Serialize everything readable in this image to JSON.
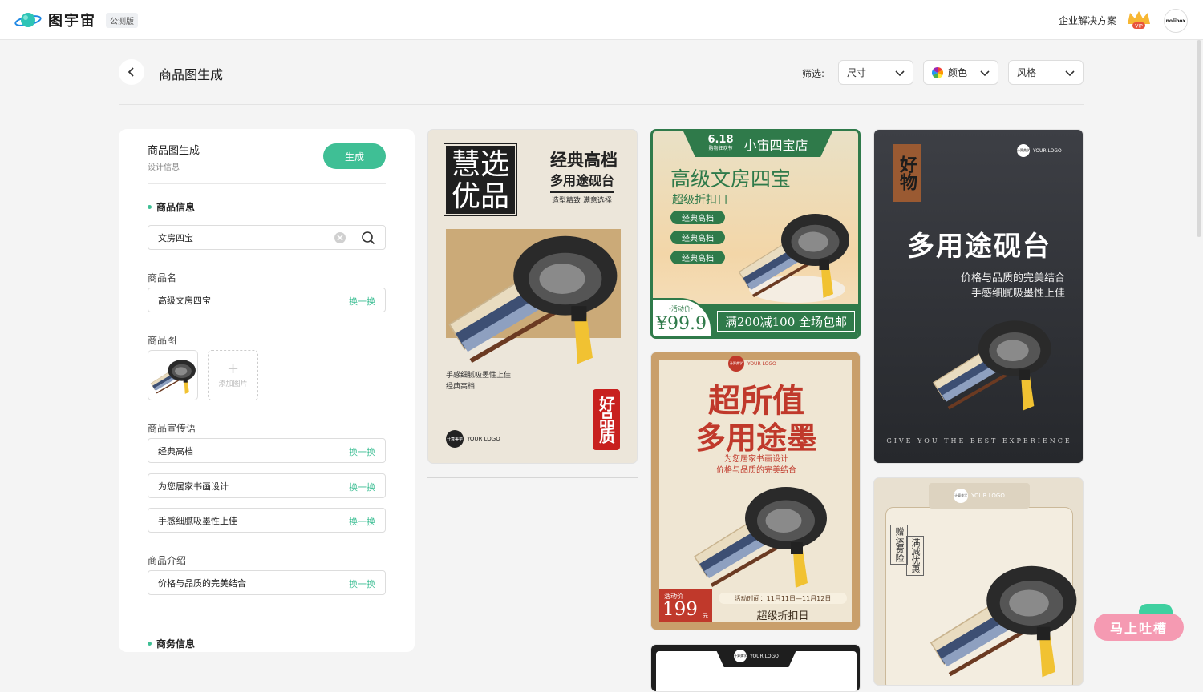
{
  "header": {
    "brand": "图宇宙",
    "beta": "公测版",
    "enterprise": "企业解决方案",
    "vip_badge": "VIP",
    "avatar": "nolibox"
  },
  "page": {
    "title": "商品图生成"
  },
  "filters": {
    "label": "筛选:",
    "size": "尺寸",
    "color": "颜色",
    "style": "风格"
  },
  "panel": {
    "title": "商品图生成",
    "subtitle": "设计信息",
    "generate": "生成",
    "product_info": "商品信息",
    "search_value": "文房四宝",
    "name_label": "商品名",
    "name_value": "高级文房四宝",
    "swap": "换一换",
    "image_label": "商品图",
    "add_image": "添加图片",
    "slogan_label": "商品宣传语",
    "slogans": [
      "经典高档",
      "为您居家书画设计",
      "手感细腻吸墨性上佳"
    ],
    "intro_label": "商品介绍",
    "intro_value": "价格与品质的完美结合",
    "business_info": "商务信息"
  },
  "cards": {
    "c1": {
      "big": "慧选优品",
      "h1": "经典高档",
      "h2": "多用途砚台",
      "sub": "造型精致 满意选择",
      "t1": "手感细腻吸墨性上佳",
      "t2": "经典高档",
      "logo": "YOUR LOGO",
      "logo_small": "计算美学",
      "seal": "好品质"
    },
    "c2": {
      "date": "6.18",
      "fest": "购物狂欢节",
      "shop": "小宙四宝店",
      "title": "高级文房四宝",
      "sub": "超级折扣日",
      "tags": [
        "经典高档",
        "经典高档",
        "经典高档"
      ],
      "price_label": "-活动价-",
      "price": "¥99.9",
      "promo": "满200减100 全场包邮"
    },
    "c3": {
      "seal": "好物",
      "title": "多用途砚台",
      "l1": "价格与品质的完美结合",
      "l2": "手感细腻吸墨性上佳",
      "footer": "GIVE YOU THE BEST EXPERIENCE",
      "logo": "YOUR LOGO",
      "logo_small": "计算美学"
    },
    "c4": {
      "logo": "YOUR LOGO",
      "logo_small": "计算美学",
      "t1": "超所值",
      "t2": "多用途墨",
      "l1": "为您居家书画设计",
      "l2": "价格与品质的完美结合",
      "price_label": "活动价",
      "price": "199",
      "unit": "元",
      "time": "活动时间：11月11日—11月12日",
      "sub": "超级折扣日"
    },
    "c5": {
      "logo": "YOUR LOGO",
      "logo_small": "计算美学",
      "v1": "赠运费险",
      "v2": "满减优惠"
    },
    "c6": {
      "logo": "YOUR LOGO",
      "logo_small": "计算美学"
    }
  },
  "feedback": {
    "label": "马上吐槽"
  }
}
